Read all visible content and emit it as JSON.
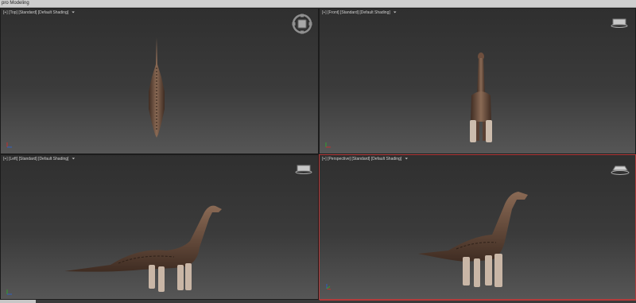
{
  "app": {
    "title": "pro Modeling"
  },
  "viewports": [
    {
      "id": "top",
      "label": "[+] [Top] [Standard] [Default Shading]",
      "active": false
    },
    {
      "id": "front",
      "label": "[+] [Front] [Standard] [Default Shading]",
      "active": false
    },
    {
      "id": "left",
      "label": "[+] [Left] [Standard] [Default Shading]",
      "active": false
    },
    {
      "id": "perspective",
      "label": "[+] [Perspective] [Standard] [Default Shading]",
      "active": true
    }
  ],
  "icons": {
    "filter": "funnel-icon",
    "steering_wheel": "steering-wheel-icon",
    "viewcube": "viewcube-icon",
    "axis_gizmo": "axis-gizmo-icon"
  },
  "colors": {
    "active_border": "#b53a3a",
    "dino_body": "#7a5a47",
    "dino_shadow": "#3f2c22",
    "dino_legs": "#c9b6a6"
  }
}
